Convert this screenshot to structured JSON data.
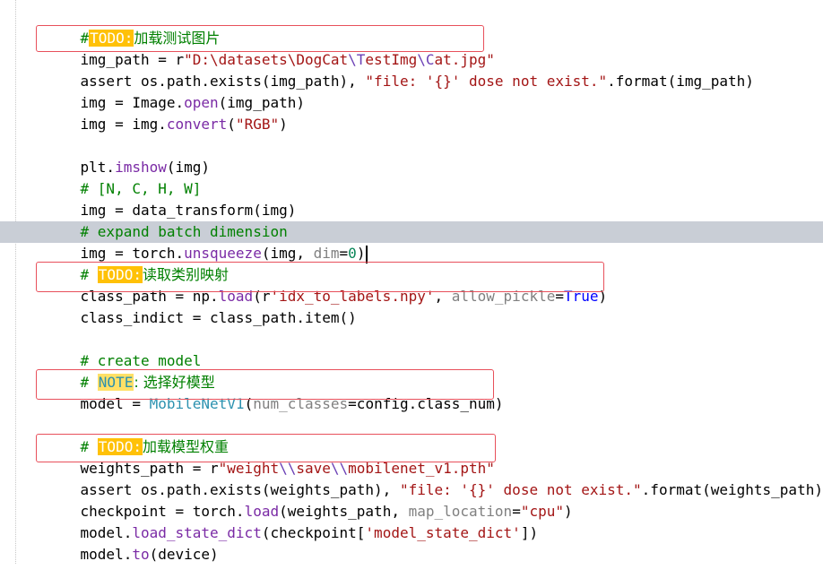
{
  "lines": {
    "l1": {
      "hash": "#",
      "tag": "TODO:",
      "text": "加载测试图片"
    },
    "l2": {
      "a": "img_path = r",
      "b": "\"D:\\datasets\\DogCat",
      "c": "\\T",
      "d": "estImg",
      "e": "\\C",
      "f": "at.jpg\""
    },
    "l3": {
      "a": "assert os.path.exists(img_path), ",
      "b": "\"file: '{}' dose not exist.\"",
      "c": ".format(img_path)"
    },
    "l4": {
      "a": "img = Image.",
      "b": "open",
      "c": "(img_path)"
    },
    "l5": {
      "a": "img = img.",
      "b": "convert",
      "c": "(",
      "d": "\"RGB\"",
      "e": ")"
    },
    "l7": {
      "a": "plt.",
      "b": "imshow",
      "c": "(img)"
    },
    "l8": {
      "text": "# [N, C, H, W]"
    },
    "l9": {
      "a": "img = data_transform(img)"
    },
    "l10": {
      "text": "# expand batch dimension"
    },
    "l11": {
      "a": "img = torch.",
      "b": "unsqueeze",
      "c": "(img, ",
      "d": "dim",
      "e": "=",
      "f": "0",
      "g": ")"
    },
    "l12": {
      "hash": "# ",
      "tag": "TODO:",
      "text": "读取类别映射"
    },
    "l13": {
      "a": "class_path = np.",
      "b": "load",
      "c": "(r",
      "d": "'idx_to_labels.npy'",
      "e": ", ",
      "f": "allow_pickle",
      "g": "=",
      "h": "True",
      "i": ")"
    },
    "l14": {
      "a": "class_indict = class_path.item()"
    },
    "l16": {
      "text": "# create model"
    },
    "l17": {
      "hash": "# ",
      "tag": "NOTE",
      "text": ": 选择好模型"
    },
    "l18": {
      "a": "model = ",
      "b": "MobileNetV1",
      "c": "(",
      "d": "num_classes",
      "e": "=config.class_num)"
    },
    "l20": {
      "hash": "# ",
      "tag": "TODO:",
      "text": "加载模型权重"
    },
    "l21": {
      "a": "weights_path = r",
      "b": "\"weight",
      "c": "\\\\",
      "d": "save",
      "e": "\\\\",
      "f": "mobilenet_v1.pth\""
    },
    "l22": {
      "a": "assert os.path.exists(weights_path), ",
      "b": "\"file: '{}' dose not exist.\"",
      "c": ".format(weights_path)"
    },
    "l23": {
      "a": "checkpoint = torch.",
      "b": "load",
      "c": "(weights_path, ",
      "d": "map_location",
      "e": "=",
      "f": "\"cpu\"",
      "g": ")"
    },
    "l24": {
      "a": "model.",
      "b": "load_state_dict",
      "c": "(checkpoint[",
      "d": "'model_state_dict'",
      "e": "])"
    },
    "l25": {
      "a": "model.",
      "b": "to",
      "c": "(device)"
    }
  },
  "colors": {
    "highlight_box": "#e8505b",
    "todo_tag": "#ffc107",
    "current_line": "#c9ced6"
  }
}
